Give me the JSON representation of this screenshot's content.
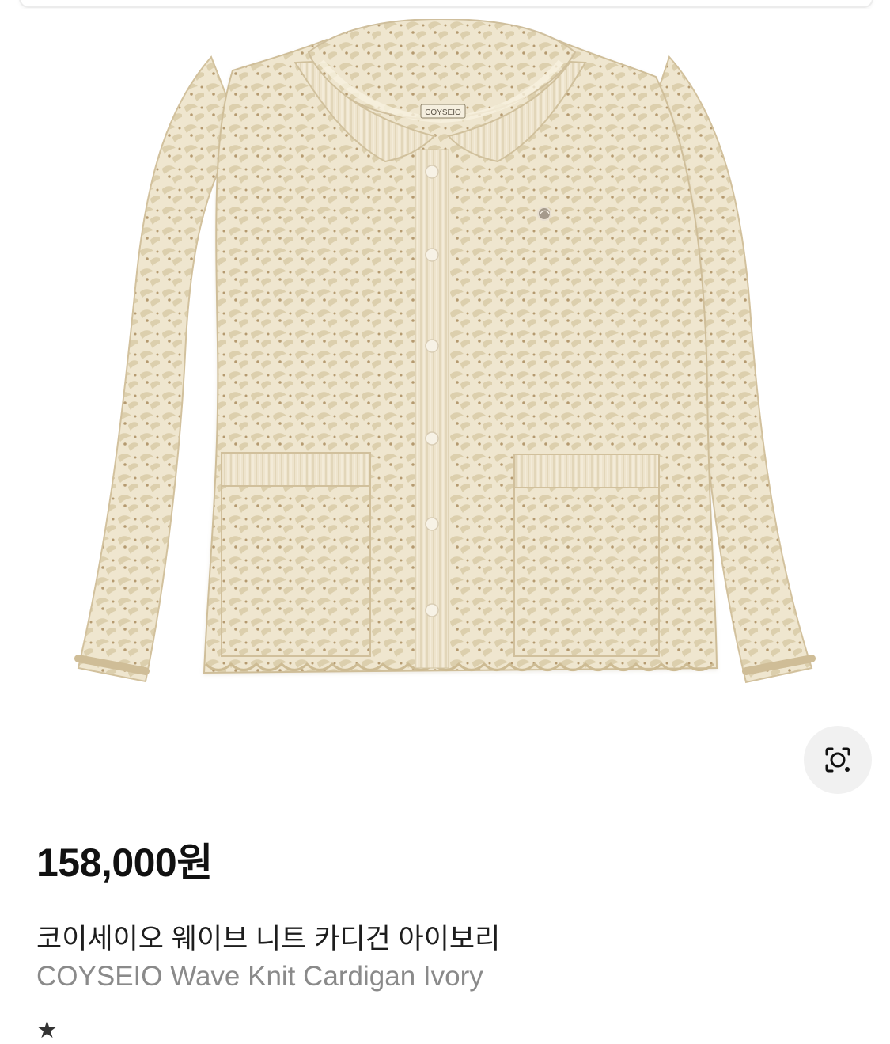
{
  "product": {
    "price": "158,000원",
    "name_ko": "코이세이오 웨이브 니트 카디건 아이보리",
    "name_en": "COYSEIO Wave Knit Cardigan Ivory",
    "brand_label": "COYSEIO",
    "image_description": "Ivory wave-pattern openwork knit cardigan with round collar, front buttons and two patch pockets"
  },
  "rating": {
    "star_icon": "star-icon",
    "text": ""
  },
  "icons": {
    "lens": "image-search-lens-icon"
  },
  "colors": {
    "knit": "#efe6cf",
    "knit_shadow": "#d8caa7",
    "lens_bg": "#f1f1f1",
    "price_text": "#111111",
    "subtitle_text": "#8a8a8a"
  }
}
